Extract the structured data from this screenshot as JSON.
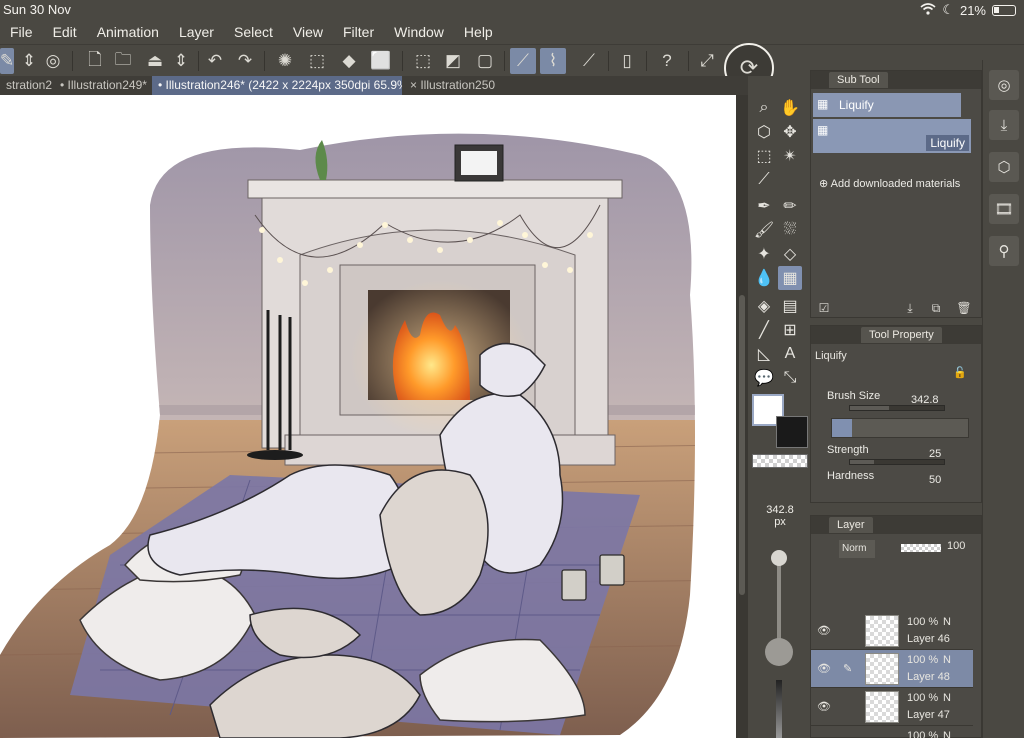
{
  "status": {
    "time": "Sun 30 Nov",
    "battery": "21%",
    "wifi_icon": "wifi-icon",
    "moon_icon": "moon-icon"
  },
  "menu": [
    "File",
    "Edit",
    "Animation",
    "Layer",
    "Select",
    "View",
    "Filter",
    "Window",
    "Help"
  ],
  "tabs": [
    {
      "label": "stration248*"
    },
    {
      "label": "• Illustration249*"
    },
    {
      "label": "• Illustration246* (2422 x 2224px 350dpi 65.9%)"
    },
    {
      "label": "× Illustration250"
    }
  ],
  "subtool": {
    "title": "Sub Tool",
    "items": [
      {
        "label": "Liquify"
      },
      {
        "label": "Liquify"
      }
    ],
    "add_label": "Add downloaded materials"
  },
  "tool_property": {
    "title": "Tool Property",
    "tool_name": "Liquify",
    "brush_size_label": "Brush Size",
    "brush_size_value": "342.8",
    "brush_size_fill": 0.42,
    "strength_label": "Strength",
    "strength_value": "25",
    "strength_fill": 0.25,
    "hardness_label": "Hardness",
    "hardness_value": "50"
  },
  "brush_preview": {
    "size": "342.8",
    "unit": "px"
  },
  "layer_panel": {
    "title": "Layer",
    "blend_mode": "Norm",
    "opacity": "100",
    "layers": [
      {
        "pct": "100 %",
        "mode": "N",
        "name": "Layer 46",
        "selected": false
      },
      {
        "pct": "100 %",
        "mode": "N",
        "name": "Layer 48",
        "selected": true
      },
      {
        "pct": "100 %",
        "mode": "N",
        "name": "Layer 47",
        "selected": false
      },
      {
        "pct": "100 %",
        "mode": "N",
        "name": "",
        "selected": false
      }
    ]
  },
  "colors": {
    "main": "#ffffff",
    "sub": "#1a1a1a",
    "accent": "#7b8aa6"
  }
}
